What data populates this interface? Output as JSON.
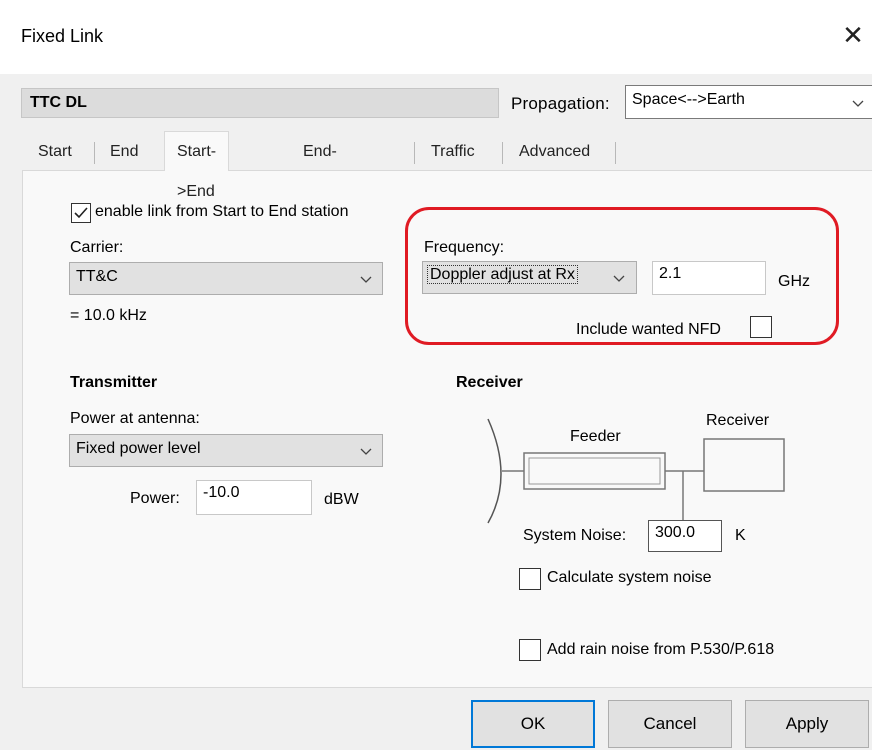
{
  "window": {
    "title": "Fixed Link",
    "close_icon": "close-icon"
  },
  "header": {
    "link_name": "TTC DL",
    "propagation_label": "Propagation:",
    "propagation_value": "Space<-->Earth"
  },
  "tabs": [
    {
      "label": "Start",
      "active": false
    },
    {
      "label": "End",
      "active": false
    },
    {
      "label": "Start->End",
      "active": true
    },
    {
      "label": "End->Start",
      "active": false
    },
    {
      "label": "Traffic",
      "active": false
    },
    {
      "label": "Advanced",
      "active": false
    }
  ],
  "link": {
    "enable_label": "enable link from Start to End station",
    "enable_checked": true,
    "carrier_label": "Carrier:",
    "carrier_value": "TT&C",
    "bandwidth_text": "= 10.0 kHz"
  },
  "frequency": {
    "label": "Frequency:",
    "mode_value": "Doppler adjust at Rx",
    "value": "2.1",
    "unit": "GHz",
    "nfd_label": "Include wanted NFD",
    "nfd_checked": false,
    "highlight_color": "#e01b24"
  },
  "transmitter": {
    "heading": "Transmitter",
    "power_at_antenna_label": "Power at antenna:",
    "power_mode_value": "Fixed power level",
    "power_label": "Power:",
    "power_value": "-10.0",
    "power_unit": "dBW"
  },
  "receiver": {
    "heading": "Receiver",
    "diagram_feeder_label": "Feeder",
    "diagram_receiver_label": "Receiver",
    "system_noise_label": "System Noise:",
    "system_noise_value": "300.0",
    "system_noise_unit": "K",
    "calc_noise_label": "Calculate system noise",
    "calc_noise_checked": false,
    "rain_noise_label": "Add rain noise from P.530/P.618",
    "rain_noise_checked": false
  },
  "buttons": {
    "ok": "OK",
    "cancel": "Cancel",
    "apply": "Apply"
  }
}
